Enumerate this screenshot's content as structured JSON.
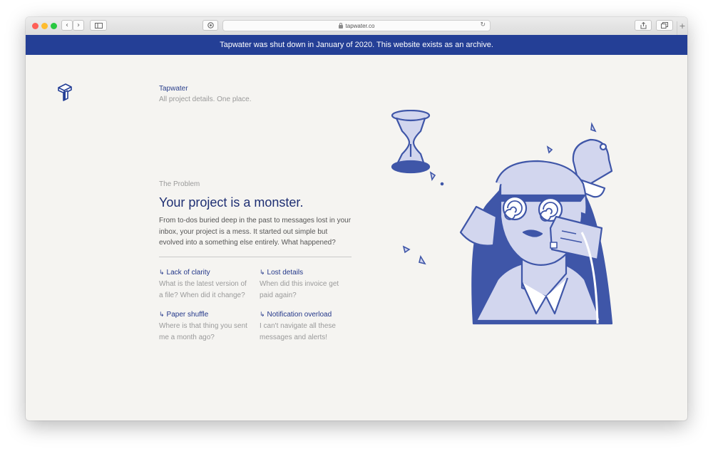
{
  "browser": {
    "url": "tapwater.co",
    "buttons": {
      "back": "‹",
      "forward": "›",
      "new_tab": "+"
    }
  },
  "banner": {
    "text": "Tapwater was shut down in January of 2020. This website exists as an archive."
  },
  "header": {
    "brand": "Tapwater",
    "tagline": "All project details. One place."
  },
  "problem_section": {
    "eyebrow": "The Problem",
    "headline": "Your project is a monster.",
    "body": "From to-dos buried deep in the past to messages lost in your inbox, your project is a mess. It started out simple but evolved into a something else entirely. What happened?",
    "arrow_glyph": "↳",
    "items": [
      {
        "title": "Lack of clarity",
        "desc": "What is the latest version of a file? When did it change?"
      },
      {
        "title": "Lost details",
        "desc": "When did this invoice get paid again?"
      },
      {
        "title": "Paper shuffle",
        "desc": "Where is that thing you sent me a month ago?"
      },
      {
        "title": "Notification overload",
        "desc": "I can't navigate all these messages and alerts!"
      }
    ]
  },
  "colors": {
    "brand_blue": "#243f96",
    "illustration_blue": "#3f56a8",
    "illustration_fill": "#d2d6ee",
    "page_bg": "#f5f4f1"
  }
}
